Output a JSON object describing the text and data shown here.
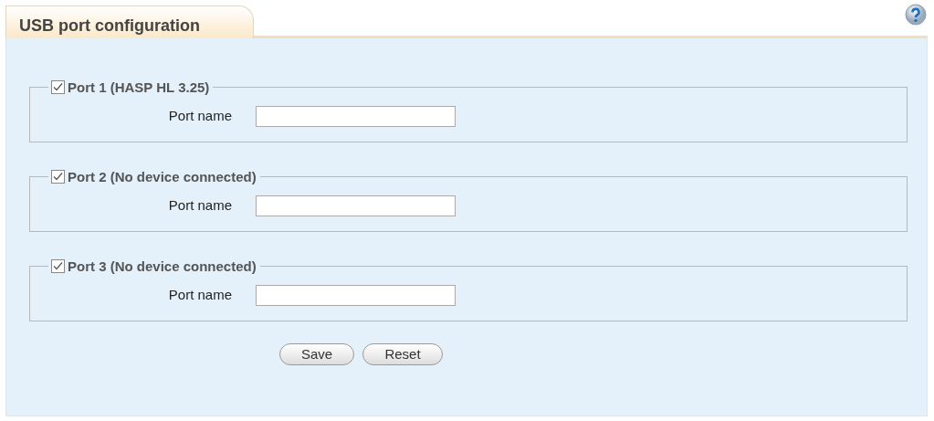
{
  "tab": {
    "title": "USB port configuration"
  },
  "ports": [
    {
      "label": "Port 1 (HASP HL 3.25)",
      "checked": true,
      "field_label": "Port name"
    },
    {
      "label": "Port 2 (No device connected)",
      "checked": true,
      "field_label": "Port name"
    },
    {
      "label": "Port 3 (No device connected)",
      "checked": true,
      "field_label": "Port name"
    }
  ],
  "buttons": [
    "Save",
    "Reset"
  ]
}
